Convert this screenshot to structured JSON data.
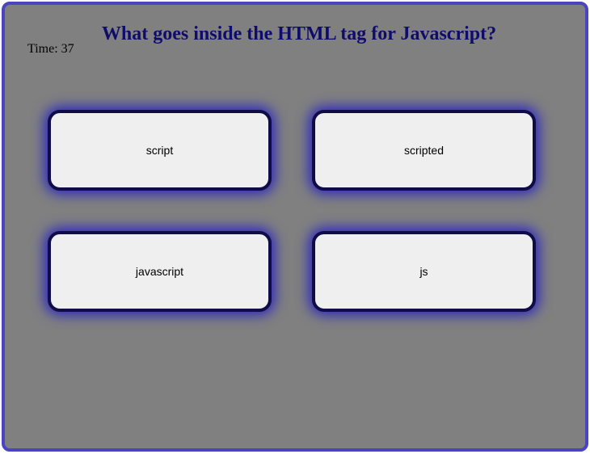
{
  "question": "What goes inside the HTML tag for Javascript?",
  "timer": {
    "label": "Time:",
    "value": "37"
  },
  "answers": [
    {
      "label": "script"
    },
    {
      "label": "scripted"
    },
    {
      "label": "javascript"
    },
    {
      "label": "js"
    }
  ],
  "colors": {
    "frame_border": "#4a44c0",
    "background": "#808080",
    "question_text": "#0f0c6c",
    "answer_border": "#0f0c48",
    "answer_glow": "#2b25c0",
    "answer_fill": "#f0eff0"
  }
}
